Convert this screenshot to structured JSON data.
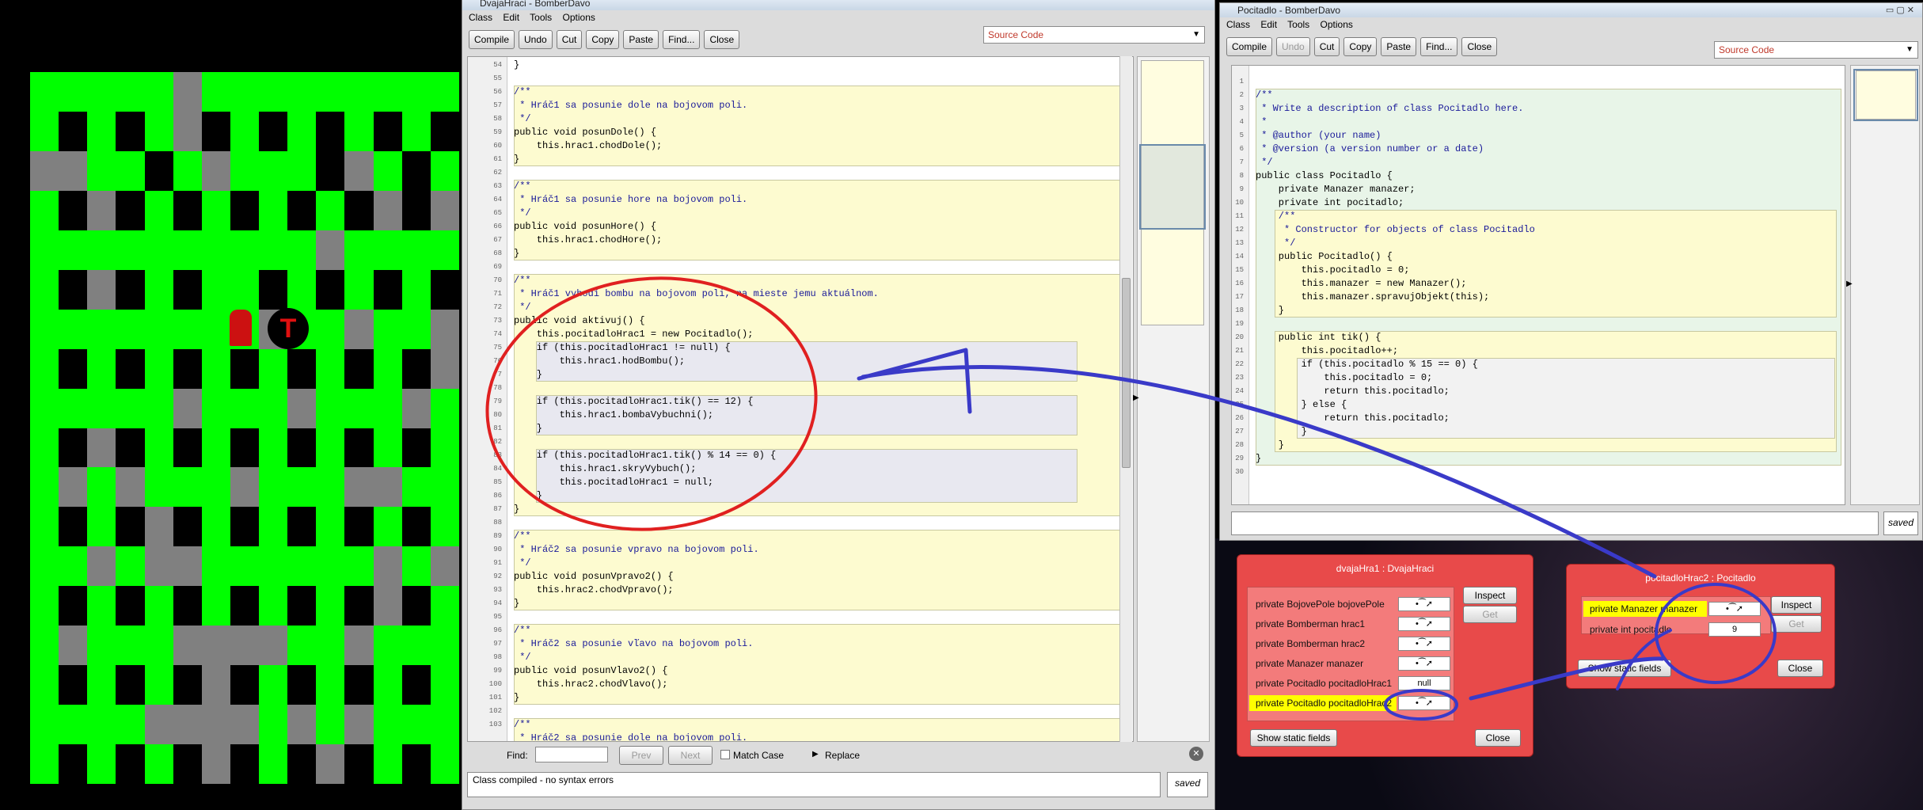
{
  "game": {
    "bomb_symbol": "T",
    "colors": {
      "wall": "#000000",
      "floor": "#808080",
      "grass": "#00ff00"
    },
    "grid": [
      "gggggwggggggggg",
      "gbgbgwbgbgbgbgb",
      "wwggbgwgggbwgbg",
      "gbwbgbgbgbgbwbw",
      "ggggggggggwgggg",
      "gbwbgbggbgbgbgb",
      "ggggggggwggwggw",
      "gbgbgbgbgbgbgbw",
      "gggggwgggwgggwg",
      "gbwbgbgbgbgbgbg",
      "gwgwgggwgggwwgg",
      "gbgbwbgbgbgbgbg",
      "ggwgwwggggggwgw",
      "gbgbgbgbgbgbwbg",
      "gwgggwwwwggwggg",
      "gbgbgbwbgbgbgbg",
      "ggggwwwwgwgwggg",
      "gbgbgbwbgbwbgbg"
    ]
  },
  "editor1": {
    "title": "DvajaHraci - BomberDavo",
    "menu": [
      "Class",
      "Edit",
      "Tools",
      "Options"
    ],
    "toolbar": [
      "Compile",
      "Undo",
      "Cut",
      "Copy",
      "Paste",
      "Find...",
      "Close"
    ],
    "view": "Source Code",
    "line_numbers": [
      "54",
      "55",
      "56",
      "57",
      "58",
      "59",
      "60",
      "61",
      "62",
      "63",
      "64",
      "65",
      "66",
      "67",
      "68",
      "69",
      "70",
      "71",
      "72",
      "73",
      "74",
      "75",
      "76",
      "77",
      "78",
      "79",
      "80",
      "81",
      "82",
      "83",
      "84",
      "85",
      "86",
      "87",
      "88",
      "89",
      "90",
      "91",
      "92",
      "93",
      "94",
      "95",
      "96",
      "97",
      "98",
      "99",
      "100",
      "101",
      "102",
      "103"
    ],
    "code": [
      "}",
      "",
      "/**",
      " * Hráč1 sa posunie dole na bojovom poli.",
      " */",
      "public void posunDole() {",
      "    this.hrac1.chodDole();",
      "}",
      "",
      "/**",
      " * Hráč1 sa posunie hore na bojovom poli.",
      " */",
      "public void posunHore() {",
      "    this.hrac1.chodHore();",
      "}",
      "",
      "/**",
      " * Hráč1 vyhodí bombu na bojovom poli, na mieste jemu aktuálnom.",
      " */",
      "public void aktivuj() {",
      "    this.pocitadloHrac1 = new Pocitadlo();",
      "    if (this.pocitadloHrac1 != null) {",
      "        this.hrac1.hodBombu();",
      "    }",
      "",
      "    if (this.pocitadloHrac1.tik() == 12) {",
      "        this.hrac1.bombaVybuchni();",
      "    }",
      "",
      "    if (this.pocitadloHrac1.tik() % 14 == 0) {",
      "        this.hrac1.skryVybuch();",
      "        this.pocitadloHrac1 = null;",
      "    }",
      "}",
      "",
      "/**",
      " * Hráč2 sa posunie vpravo na bojovom poli.",
      " */",
      "public void posunVpravo2() {",
      "    this.hrac2.chodVpravo();",
      "}",
      "",
      "/**",
      " * Hráč2 sa posunie vľavo na bojovom poli.",
      " */",
      "public void posunVlavo2() {",
      "    this.hrac2.chodVlavo();",
      "}",
      "",
      "/**",
      " * Hráč2 sa posunie dole na bojovom poli."
    ],
    "find_label": "Find:",
    "prev": "Prev",
    "next": "Next",
    "match_case": "Match Case",
    "replace": "Replace",
    "status": "Class compiled - no syntax errors",
    "saved": "saved"
  },
  "editor2": {
    "title": "Pocitadlo - BomberDavo",
    "menu": [
      "Class",
      "Edit",
      "Tools",
      "Options"
    ],
    "toolbar": [
      "Compile",
      "Undo",
      "Cut",
      "Copy",
      "Paste",
      "Find...",
      "Close"
    ],
    "view": "Source Code",
    "line_numbers": [
      "1",
      "2",
      "3",
      "4",
      "5",
      "6",
      "7",
      "8",
      "9",
      "10",
      "11",
      "12",
      "13",
      "14",
      "15",
      "16",
      "17",
      "18",
      "19",
      "20",
      "21",
      "22",
      "23",
      "24",
      "25",
      "26",
      "27",
      "28",
      "29",
      "30"
    ],
    "code": [
      "",
      "/**",
      " * Write a description of class Pocitadlo here.",
      " *",
      " * @author (your name)",
      " * @version (a version number or a date)",
      " */",
      "public class Pocitadlo {",
      "    private Manazer manazer;",
      "    private int pocitadlo;",
      "    /**",
      "     * Constructor for objects of class Pocitadlo",
      "     */",
      "    public Pocitadlo() {",
      "        this.pocitadlo = 0;",
      "        this.manazer = new Manazer();",
      "        this.manazer.spravujObjekt(this);",
      "    }",
      "",
      "    public int tik() {",
      "        this.pocitadlo++;",
      "        if (this.pocitadlo % 15 == 0) {",
      "            this.pocitadlo = 0;",
      "            return this.pocitadlo;",
      "        } else {",
      "            return this.pocitadlo;",
      "        }",
      "    }",
      "}",
      ""
    ],
    "saved": "saved"
  },
  "inspector1": {
    "title": "dvajaHra1 : DvajaHraci",
    "fields": [
      {
        "label": "private BojovePole bojovePole",
        "value": "ref"
      },
      {
        "label": "private Bomberman hrac1",
        "value": "ref"
      },
      {
        "label": "private Bomberman hrac2",
        "value": "ref"
      },
      {
        "label": "private Manazer manazer",
        "value": "ref"
      },
      {
        "label": "private Pocitadlo pocitadloHrac1",
        "value": "null"
      },
      {
        "label": "private Pocitadlo pocitadloHrac2",
        "value": "ref"
      }
    ],
    "inspect": "Inspect",
    "get": "Get",
    "show_static": "Show static fields",
    "close": "Close"
  },
  "inspector2": {
    "title": "pocitadloHrac2 : Pocitadlo",
    "fields": [
      {
        "label": "private Manazer manazer",
        "value": "ref"
      },
      {
        "label": "private int pocitadlo",
        "value": "9"
      }
    ],
    "inspect": "Inspect",
    "get": "Get",
    "show_static": "Show static fields",
    "close": "Close"
  },
  "accent": {
    "annotation_red": "#e02020",
    "annotation_blue": "#3a3ac8",
    "highlight": "#ffff00"
  }
}
